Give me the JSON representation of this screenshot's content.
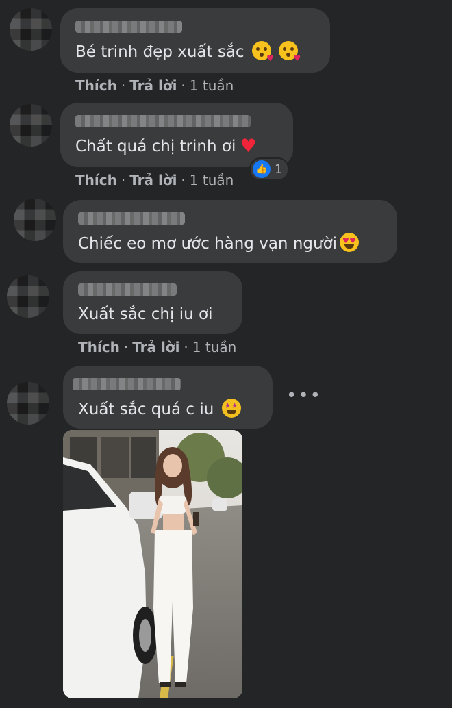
{
  "comments": [
    {
      "text": "Bé trinh đẹp xuất sắc",
      "emojis": [
        "kissing-heart-icon",
        "kissing-heart-icon"
      ],
      "actions": {
        "like": "Thích",
        "reply": "Trả lời",
        "time": "1 tuần"
      }
    },
    {
      "text": "Chất quá chị trinh ơi",
      "emojis": [
        "red-heart-icon"
      ],
      "reaction": {
        "icon": "like-icon",
        "count": "1"
      },
      "actions": {
        "like": "Thích",
        "reply": "Trả lời",
        "time": "1 tuần"
      }
    },
    {
      "text": "Chiếc eo mơ ước hàng vạn người",
      "emojis": [
        "heart-eyes-icon"
      ]
    },
    {
      "text": "Xuất sắc chị iu ơi",
      "actions": {
        "like": "Thích",
        "reply": "Trả lời",
        "time": "1 tuần"
      }
    },
    {
      "text": "Xuất sắc quá c iu",
      "emojis": [
        "star-struck-icon"
      ],
      "more_icon": "more-horizontal-icon",
      "attachment": "photo"
    }
  ],
  "colors": {
    "background": "#242526",
    "bubble": "#3a3b3c",
    "text": "#e4e6eb",
    "meta": "#b0b3b8",
    "like_blue": "#1877f2"
  }
}
